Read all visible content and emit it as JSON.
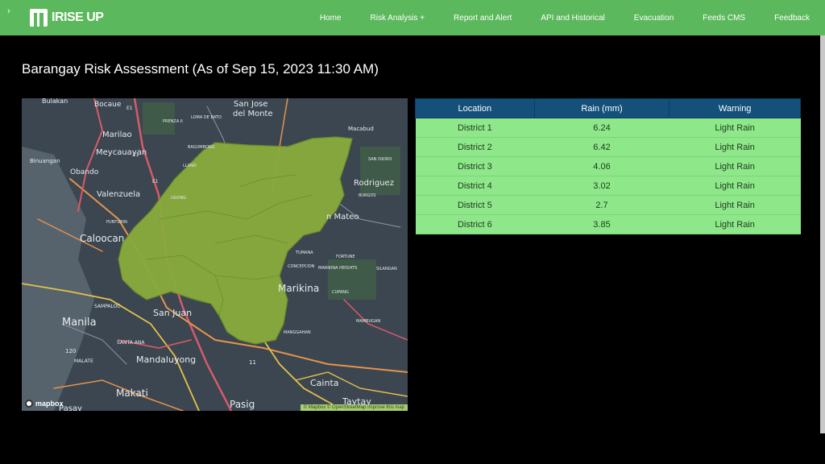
{
  "navbar": {
    "toggle": "›",
    "brand": "IRISE UP",
    "links": [
      "Home",
      "Risk Analysis +",
      "Report and Alert",
      "API and Historical",
      "Evacuation",
      "Feeds CMS",
      "Feedback"
    ]
  },
  "page": {
    "title": "Barangay Risk Assessment (As of Sep 15, 2023 11:30 AM)"
  },
  "map": {
    "labels": {
      "bulakan": "Bulakan",
      "bocaue": "Bocaue",
      "e1a": "E1",
      "sanjose": "San Jose",
      "delmonte": "del Monte",
      "macabud": "Macabud",
      "marilao": "Marilao",
      "meycauayan": "Meycauayan",
      "binuangan": "Binuangan",
      "obando": "Obando",
      "valenzuela": "Valenzuela",
      "caloocan": "Caloocan",
      "rodriguez": "Rodriguez",
      "sanmateo": "n Mateo",
      "burgos": "BURGOS",
      "sanisidro": "SAN ISIDRO",
      "tumana": "TUMANA",
      "fortune": "FORTUNE",
      "silangan": "SILANGAN",
      "marikinaheights": "MARIKINA HEIGHTS",
      "marikina": "Marikina",
      "concepcion": "CONCEPCION",
      "cupang": "CUPANG",
      "sampaloc": "SAMPALOC",
      "sanjuan": "San Juan",
      "manila": "Manila",
      "santaana": "SANTA ANA",
      "mandaluyong": "Mandaluyong",
      "malate": "MALATE",
      "makati": "Makati",
      "pasig": "Pasig",
      "cainta": "Cainta",
      "taytay": "Taytay",
      "pasay": "Pasay",
      "mambugan": "MAMBUGAN",
      "manggahan": "MANGGAHAN",
      "r120": "120",
      "r11": "11",
      "e1b": "E1",
      "e1c": "E1",
      "prenza": "PRENZA II",
      "lomadebato": "LOMA DE BATO",
      "bagumbong": "BAGUMBONG",
      "llano": "LLANO",
      "ugong": "UGONG",
      "punturin": "PUNTURIN"
    },
    "logo": "mapbox",
    "attribution": "© Mapbox © OpenStreetMap Improve this map"
  },
  "table": {
    "headers": [
      "Location",
      "Rain (mm)",
      "Warning"
    ],
    "rows": [
      [
        "District 1",
        "6.24",
        "Light Rain"
      ],
      [
        "District 2",
        "6.42",
        "Light Rain"
      ],
      [
        "District 3",
        "4.06",
        "Light Rain"
      ],
      [
        "District 4",
        "3.02",
        "Light Rain"
      ],
      [
        "District 5",
        "2.7",
        "Light Rain"
      ],
      [
        "District 6",
        "3.85",
        "Light Rain"
      ]
    ]
  },
  "colors": {
    "navbar": "#5cb85c",
    "table_header": "#14507a",
    "table_row": "#8ee88a",
    "overlay": "#8aab3c"
  }
}
